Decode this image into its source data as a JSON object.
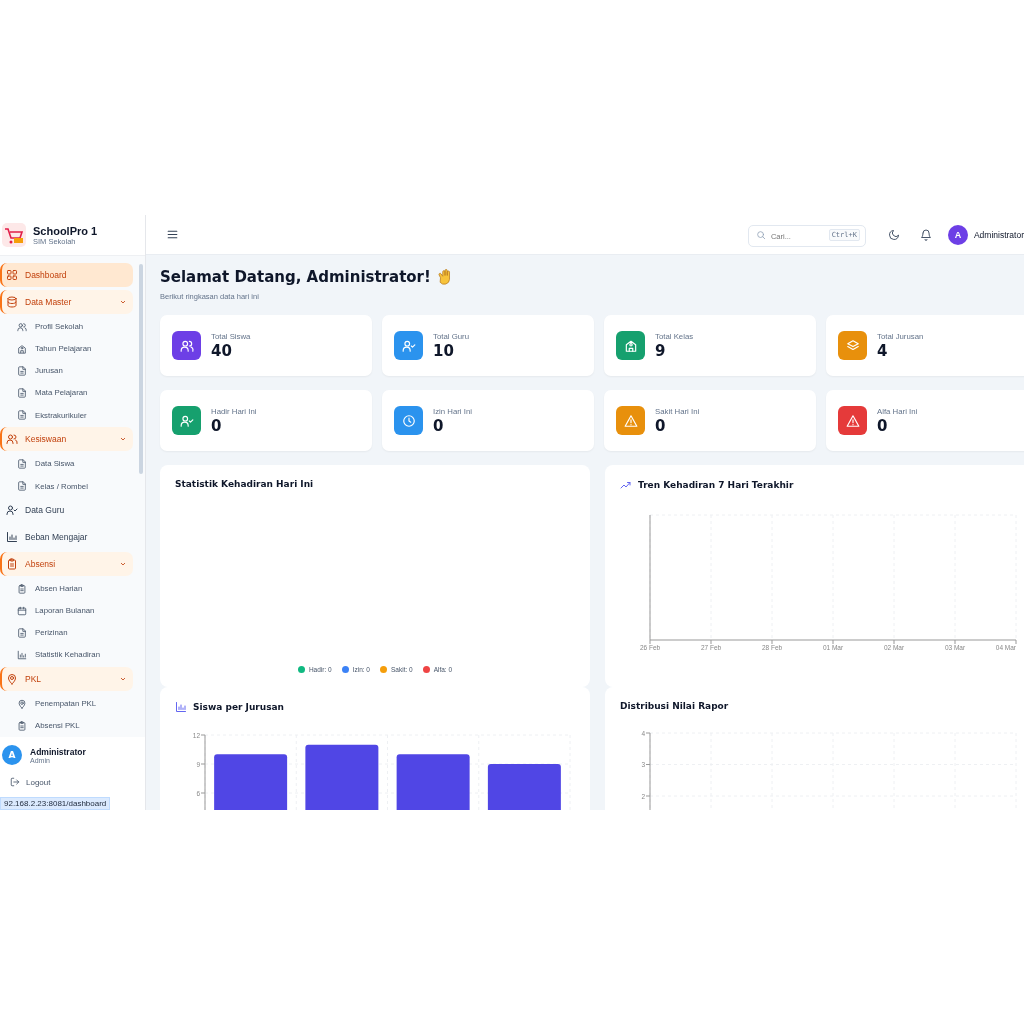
{
  "sidebar": {
    "brand": {
      "name": "SchoolPro 1",
      "subtitle": "SIM Sekolah"
    },
    "items": [
      {
        "label": "Dashboard",
        "selected": true
      },
      {
        "label": "Data Master",
        "selected": false,
        "expanded": true,
        "children": [
          {
            "label": "Profil Sekolah",
            "selected": false
          },
          {
            "label": "Tahun Pelajaran",
            "selected": false
          },
          {
            "label": "Jurusan",
            "selected": false
          },
          {
            "label": "Mata Pelajaran",
            "selected": false
          },
          {
            "label": "Ekstrakurikuler",
            "selected": false
          }
        ]
      },
      {
        "label": "Kesiswaan",
        "selected": false,
        "expanded": true,
        "children": [
          {
            "label": "Data Siswa",
            "selected": false
          },
          {
            "label": "Kelas / Rombel",
            "selected": false
          }
        ]
      },
      {
        "label": "Data Guru",
        "selected": false
      },
      {
        "label": "Beban Mengajar",
        "selected": false
      },
      {
        "label": "Absensi",
        "selected": false,
        "expanded": true,
        "children": [
          {
            "label": "Absen Harian",
            "selected": false
          },
          {
            "label": "Laporan Bulanan",
            "selected": false
          },
          {
            "label": "Perizinan",
            "selected": false
          },
          {
            "label": "Statistik Kehadiran",
            "selected": false
          }
        ]
      },
      {
        "label": "PKL",
        "selected": false,
        "expanded": true,
        "children": [
          {
            "label": "Penempatan PKL",
            "selected": false
          },
          {
            "label": "Absensi PKL",
            "selected": false
          }
        ]
      }
    ],
    "user": {
      "initial": "A",
      "name": "Administrator",
      "role": "Admin"
    },
    "logout": "Logout"
  },
  "status_bar": {
    "url": "92.168.2.23:8081/dashboard"
  },
  "topbar": {
    "search": {
      "placeholder": "Cari...",
      "shortcut": "Ctrl+K"
    },
    "user": {
      "initial": "A",
      "name": "Administrator"
    }
  },
  "greeting": {
    "title": "Selamat Datang, Administrator!",
    "subtitle": "Berikut ringkasan data hari ini"
  },
  "stats": [
    {
      "label": "Total Siswa",
      "value": "40",
      "color": "#6d3fe6"
    },
    {
      "label": "Total Guru",
      "value": "10",
      "color": "#2b93ee"
    },
    {
      "label": "Total Kelas",
      "value": "9",
      "color": "#16a06e"
    },
    {
      "label": "Total Jurusan",
      "value": "4",
      "color": "#e8900c"
    },
    {
      "label": "Hadir Hari Ini",
      "value": "0",
      "color": "#16a06e"
    },
    {
      "label": "Izin Hari Ini",
      "value": "0",
      "color": "#2b93ee"
    },
    {
      "label": "Sakit Hari Ini",
      "value": "0",
      "color": "#e8900c"
    },
    {
      "label": "Alfa Hari Ini",
      "value": "0",
      "color": "#e53a3a"
    }
  ],
  "attendance_card": {
    "title": "Statistik Kehadiran Hari Ini",
    "legend": [
      {
        "label": "Hadir: 0",
        "color": "#10b981"
      },
      {
        "label": "Izin: 0",
        "color": "#3b82f6"
      },
      {
        "label": "Sakit: 0",
        "color": "#f59e0b"
      },
      {
        "label": "Alfa: 0",
        "color": "#ef4444"
      }
    ]
  },
  "trend_card": {
    "chart_data": {
      "type": "other",
      "title": "Tren Kehadiran 7 Hari Terakhir",
      "categories": [
        "26 Feb",
        "27 Feb",
        "28 Feb",
        "01 Mar",
        "02 Mar",
        "03 Mar",
        "04 Mar"
      ]
    }
  },
  "major_card": {
    "chart_data": {
      "type": "bar",
      "title": "Siswa per Jurusan",
      "categories": [
        null,
        null,
        null,
        null
      ],
      "values": [
        10,
        11,
        10,
        9
      ],
      "ylim": [
        0,
        12
      ],
      "yticks": [
        6,
        9,
        12
      ]
    }
  },
  "grades_card": {
    "chart_data": {
      "type": "bar",
      "title": "Distribusi Nilai Rapor",
      "categories": [
        null,
        null,
        null,
        null,
        null,
        null
      ],
      "values": [
        null,
        null,
        null,
        null,
        null,
        null
      ],
      "ylim": [
        0,
        4
      ],
      "yticks": [
        2,
        3,
        4
      ]
    }
  }
}
